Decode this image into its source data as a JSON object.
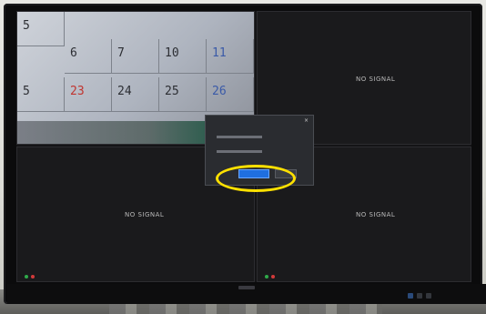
{
  "tiles": [
    {
      "id": "ch1",
      "label": ""
    },
    {
      "id": "ch2",
      "label": "NO SIGNAL",
      "tag": ""
    },
    {
      "id": "ch3",
      "label": "NO SIGNAL"
    },
    {
      "id": "ch4",
      "label": "NO SIGNAL"
    }
  ],
  "calendar": {
    "row1": [
      "5",
      "6",
      "7",
      "10",
      "11"
    ],
    "row2": [
      "5",
      "23",
      "24",
      "25",
      "26"
    ]
  },
  "popup": {
    "title": "",
    "rows": [
      {
        "label": "",
        "value": ""
      },
      {
        "label": "",
        "value": ""
      }
    ],
    "confirm_label": "",
    "cancel_label": ""
  },
  "monitor": {
    "brand": "",
    "accent": "#1f6fe0",
    "highlight": "#ffe100"
  }
}
